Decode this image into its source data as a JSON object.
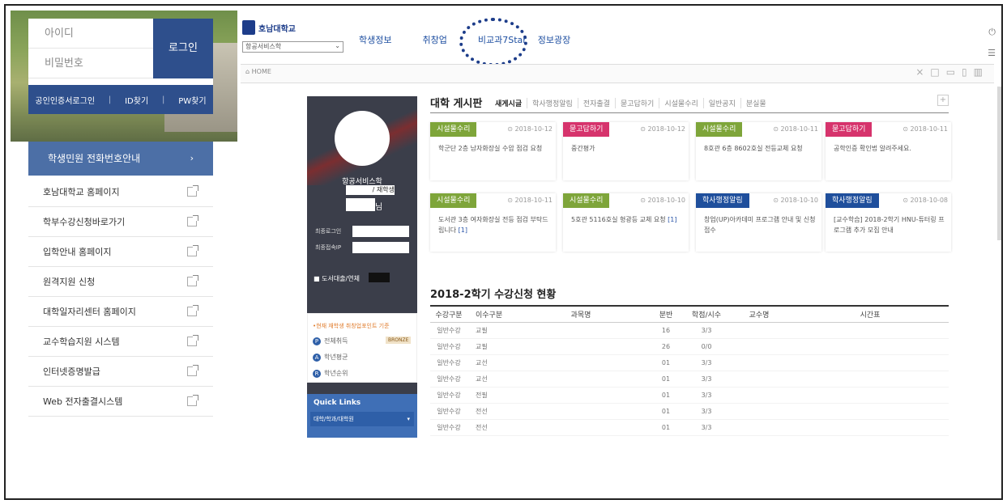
{
  "login": {
    "id_label": "아이디",
    "pw_label": "비밀번호",
    "login_button": "로그인",
    "cert_login": "공인인증서로그인",
    "id_find": "ID찾기",
    "pw_find": "PW찾기"
  },
  "phone_banner": "학생민원 전화번호안내",
  "menu": [
    "호남대학교 홈페이지",
    "학부수강신청바로가기",
    "입학안내 홈페이지",
    "원격지원 신청",
    "대학일자리센터 홈페이지",
    "교수학습지원 시스템",
    "인터넷증명발급",
    "Web 전자출결시스템"
  ],
  "header": {
    "logo_text": "호남대학교",
    "dept_select": "항공서비스학",
    "nav": [
      "학생정보",
      "취창업",
      "비교과7Star",
      "정보광장"
    ],
    "home": "HOME"
  },
  "profile": {
    "dept": "항공서비스학",
    "status": "/ 재학생",
    "suffix": "님",
    "last_login": "최종로그인",
    "last_ip": "최종접속IP",
    "library": "도서대출/연체",
    "point_note": "•현재 재학생 취창업포인트 기준",
    "total_label": "전체취득",
    "total_rank": "BRONZE",
    "avg_label": "학년평균",
    "rank_label": "학년순위",
    "quick_title": "Quick Links",
    "quick_select": "대학/학과/대학원"
  },
  "board": {
    "title": "대학 게시판",
    "tabs": [
      "새게시글",
      "학사행정알림",
      "전자출결",
      "묻고답하기",
      "시설물수리",
      "일반공지",
      "분실물"
    ],
    "cards": [
      {
        "tag": "시설물수리",
        "color": "#7ea53a",
        "date": "2018-10-12",
        "text": "학군단 2층 남자화장실 수압 점검 요청",
        "link": ""
      },
      {
        "tag": "묻고답하기",
        "color": "#d6336c",
        "date": "2018-10-12",
        "text": "중간평가",
        "link": ""
      },
      {
        "tag": "시설물수리",
        "color": "#7ea53a",
        "date": "2018-10-11",
        "text": "8호관 6층 8602호실 전등교체 요청",
        "link": ""
      },
      {
        "tag": "묻고답하기",
        "color": "#d6336c",
        "date": "2018-10-11",
        "text": "공학인증 확인법 알려주세요.",
        "link": ""
      },
      {
        "tag": "시설물수리",
        "color": "#7ea53a",
        "date": "2018-10-11",
        "text": "도서관 3층 여자화장실 전등 점검 부탁드립니다",
        "link": "[1]"
      },
      {
        "tag": "시설물수리",
        "color": "#7ea53a",
        "date": "2018-10-10",
        "text": "5호관 5116호실 형광등 교체 요청",
        "link": "[1]"
      },
      {
        "tag": "학사행정알림",
        "color": "#1f4f9c",
        "date": "2018-10-10",
        "text": "창업(UP)아카데미 프로그램 안내 및 신청 접수",
        "link": ""
      },
      {
        "tag": "학사행정알림",
        "color": "#1f4f9c",
        "date": "2018-10-08",
        "text": "[교수학습] 2018-2학기 HNU-튜터링 프로그램 추가 모집 안내",
        "link": ""
      }
    ]
  },
  "course": {
    "title": "2018-2학기 수강신청 현황",
    "columns": [
      "수강구분",
      "이수구분",
      "과목명",
      "분반",
      "학점/시수",
      "교수명",
      "시간표"
    ],
    "rows": [
      [
        "일반수강",
        "교필",
        "",
        "16",
        "3/3",
        "",
        ""
      ],
      [
        "일반수강",
        "교필",
        "",
        "26",
        "0/0",
        "",
        ""
      ],
      [
        "일반수강",
        "교선",
        "",
        "01",
        "3/3",
        "",
        ""
      ],
      [
        "일반수강",
        "교선",
        "",
        "01",
        "3/3",
        "",
        ""
      ],
      [
        "일반수강",
        "전필",
        "",
        "01",
        "3/3",
        "",
        ""
      ],
      [
        "일반수강",
        "전선",
        "",
        "01",
        "3/3",
        "",
        ""
      ],
      [
        "일반수강",
        "전선",
        "",
        "01",
        "3/3",
        "",
        ""
      ]
    ]
  }
}
